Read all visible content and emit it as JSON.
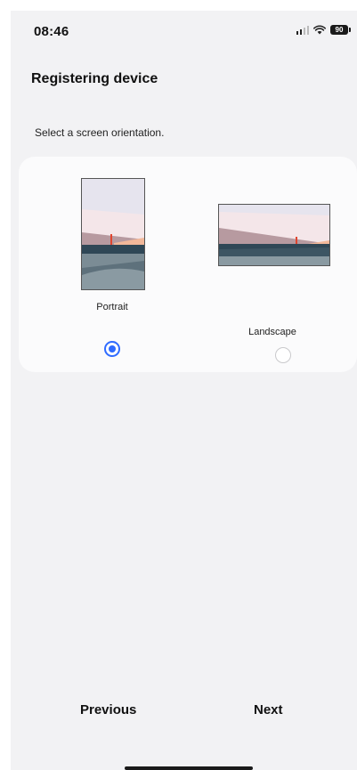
{
  "status_bar": {
    "time": "08:46",
    "battery_level": "90",
    "icons": [
      "signal-icon",
      "wifi-icon",
      "battery-icon"
    ]
  },
  "header": {
    "title": "Registering device"
  },
  "main": {
    "instruction": "Select a screen orientation.",
    "options": [
      {
        "label": "Portrait",
        "selected": true
      },
      {
        "label": "Landscape",
        "selected": false
      }
    ]
  },
  "footer": {
    "previous_label": "Previous",
    "next_label": "Next"
  },
  "colors": {
    "accent": "#2f6bff",
    "background": "#f2f2f4",
    "card": "#fbfbfc"
  }
}
